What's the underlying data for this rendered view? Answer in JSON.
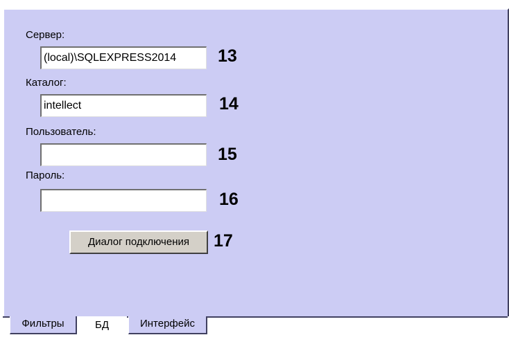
{
  "form": {
    "server_label": "Сервер:",
    "server_value": "(local)\\SQLEXPRESS2014",
    "server_num": "13",
    "catalog_label": "Каталог:",
    "catalog_value": "intellect",
    "catalog_num": "14",
    "user_label": "Пользователь:",
    "user_value": "",
    "user_num": "15",
    "password_label": "Пароль:",
    "password_value": "",
    "password_num": "16",
    "connect_button": "Диалог подключения",
    "connect_num": "17"
  },
  "tabs": [
    {
      "label": "Фильтры",
      "active": false
    },
    {
      "label": "БД",
      "active": true
    },
    {
      "label": "Интерфейс",
      "active": false
    }
  ],
  "colors": {
    "panel_bg": "#ccccf4",
    "button_bg": "#d4d0c8"
  }
}
